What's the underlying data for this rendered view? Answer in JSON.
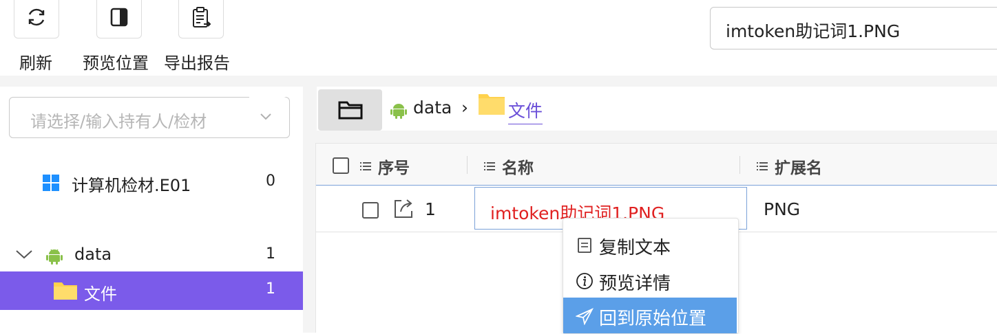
{
  "toolbar": {
    "refresh_label": "刷新",
    "preview_location_label": "预览位置",
    "export_report_label": "导出报告"
  },
  "search": {
    "value": "imtoken助记词1.PNG"
  },
  "left_panel": {
    "owner_select_placeholder": "请选择/输入持有人/检材",
    "tree": [
      {
        "label": "计算机检材.E01",
        "count": "0",
        "icon": "windows-icon"
      },
      {
        "label": "data",
        "count": "1",
        "icon": "android-icon",
        "expanded": true
      },
      {
        "label": "文件",
        "count": "1",
        "icon": "folder-icon",
        "selected": true
      }
    ]
  },
  "breadcrumb": {
    "root": "data",
    "separator": "›",
    "current": "文件"
  },
  "table": {
    "columns": [
      "序号",
      "名称",
      "扩展名"
    ],
    "rows": [
      {
        "index": "1",
        "name": "imtoken助记词1.PNG",
        "ext": "PNG"
      }
    ]
  },
  "context_menu": {
    "items": [
      {
        "label": "复制文本",
        "icon": "copy-text-icon"
      },
      {
        "label": "预览详情",
        "icon": "info-icon"
      },
      {
        "label": "回到原始位置",
        "icon": "send-icon",
        "highlighted": true
      }
    ]
  },
  "colors": {
    "selected_bg": "#7b5bea",
    "menu_highlight": "#5b9fe8",
    "error_red": "#e02020",
    "link_purple": "#6a4fd8",
    "android_green": "#8ac14a",
    "folder_yellow": "#ffd24d",
    "windows_blue": "#1e90ff"
  }
}
